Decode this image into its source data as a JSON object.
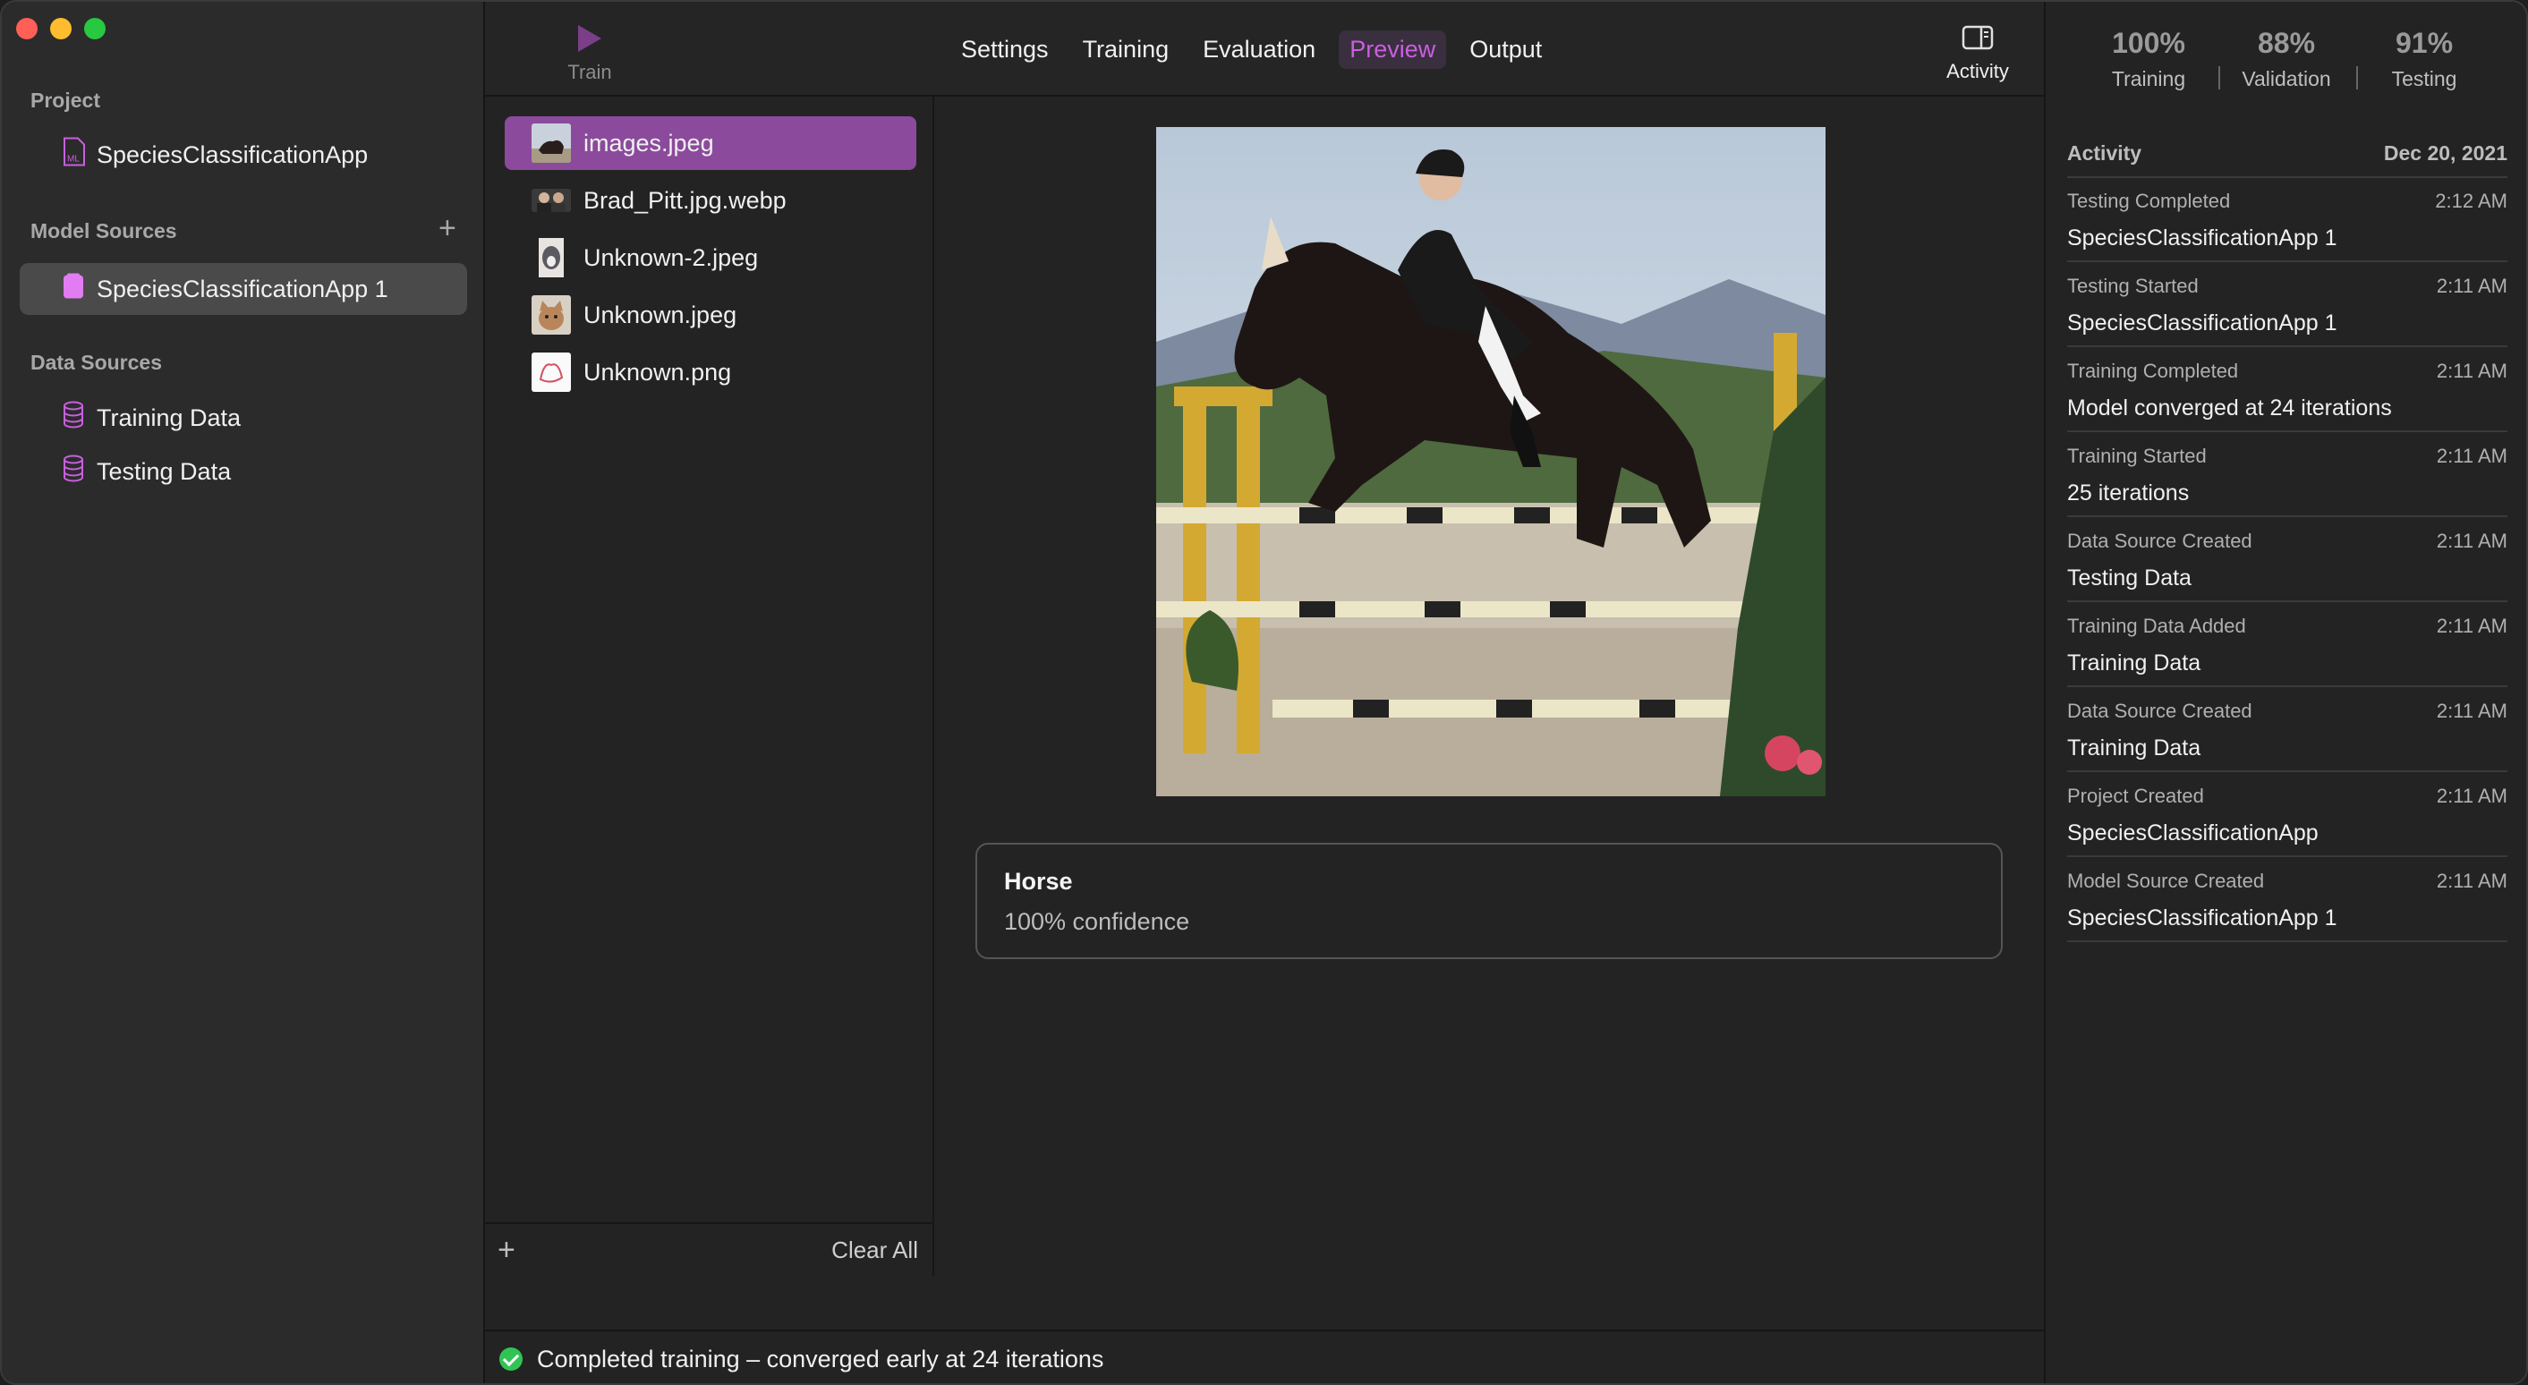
{
  "sidebar": {
    "project_header": "Project",
    "project_item": "SpeciesClassificationApp",
    "model_sources_header": "Model Sources",
    "model_source_item": "SpeciesClassificationApp 1",
    "data_sources_header": "Data Sources",
    "data_sources": [
      "Training Data",
      "Testing Data"
    ]
  },
  "toolbar": {
    "train_label": "Train",
    "tabs": [
      "Settings",
      "Training",
      "Evaluation",
      "Preview",
      "Output"
    ],
    "active_tab": "Preview",
    "activity_label": "Activity"
  },
  "files": {
    "items": [
      "images.jpeg",
      "Brad_Pitt.jpg.webp",
      "Unknown-2.jpeg",
      "Unknown.jpeg",
      "Unknown.png"
    ],
    "selected": "images.jpeg",
    "clear_all": "Clear All"
  },
  "preview": {
    "label": "Horse",
    "confidence": "100% confidence"
  },
  "status": {
    "message": "Completed training – converged early at 24 iterations"
  },
  "metrics": [
    {
      "value": "100%",
      "label": "Training"
    },
    {
      "value": "88%",
      "label": "Validation"
    },
    {
      "value": "91%",
      "label": "Testing"
    }
  ],
  "activity": {
    "title": "Activity",
    "date": "Dec 20, 2021",
    "events": [
      {
        "event": "Testing Completed",
        "time": "2:12 AM",
        "detail": "SpeciesClassificationApp 1"
      },
      {
        "event": "Testing Started",
        "time": "2:11 AM",
        "detail": "SpeciesClassificationApp 1"
      },
      {
        "event": "Training Completed",
        "time": "2:11 AM",
        "detail": "Model converged at 24 iterations"
      },
      {
        "event": "Training Started",
        "time": "2:11 AM",
        "detail": "25 iterations"
      },
      {
        "event": "Data Source Created",
        "time": "2:11 AM",
        "detail": "Testing Data"
      },
      {
        "event": "Training Data Added",
        "time": "2:11 AM",
        "detail": "Training Data"
      },
      {
        "event": "Data Source Created",
        "time": "2:11 AM",
        "detail": "Training Data"
      },
      {
        "event": "Project Created",
        "time": "2:11 AM",
        "detail": "SpeciesClassificationApp"
      },
      {
        "event": "Model Source Created",
        "time": "2:11 AM",
        "detail": "SpeciesClassificationApp 1"
      }
    ]
  },
  "colors": {
    "accent": "#8b4a9c",
    "accent_text": "#c95fe0",
    "success": "#31c455"
  }
}
